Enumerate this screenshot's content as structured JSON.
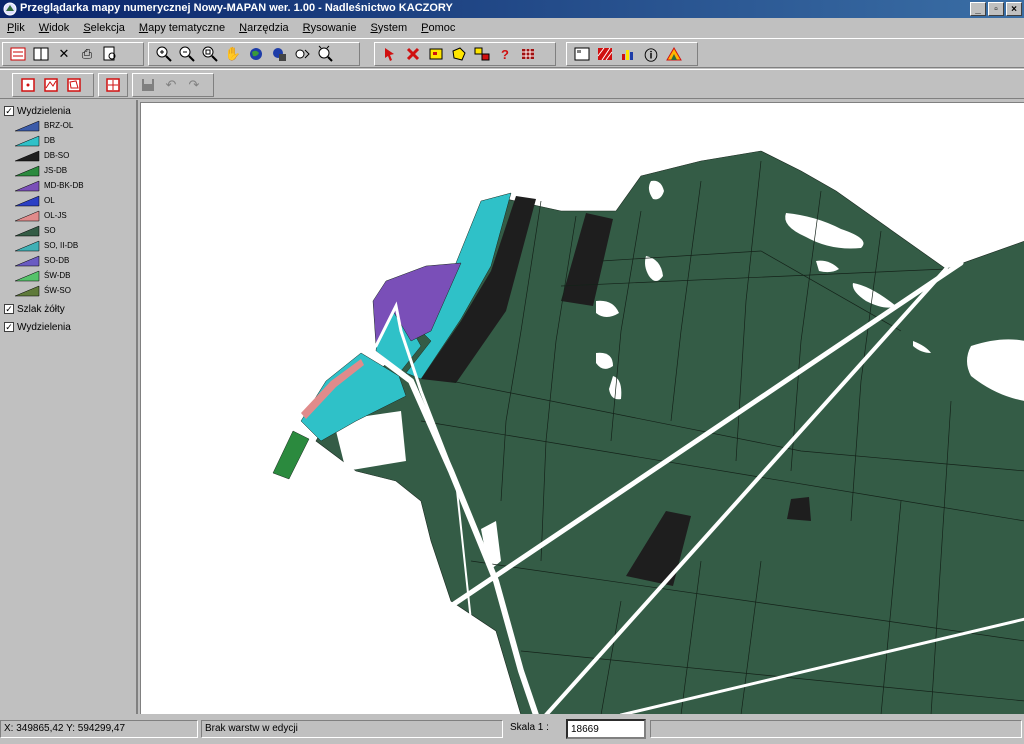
{
  "window": {
    "title": "Przeglądarka mapy numerycznej Nowy-MAPAN wer. 1.00 - Nadleśnictwo KACZORY",
    "minimize": "_",
    "maximize": "▫",
    "close": "×"
  },
  "menu": [
    "Plik",
    "Widok",
    "Selekcja",
    "Mapy tematyczne",
    "Narzędzia",
    "Rysowanie",
    "System",
    "Pomoc"
  ],
  "toolbar": {
    "glyphs": {
      "delete": "✕",
      "print": "⎙",
      "hand": "✋",
      "help": "?",
      "info": "ⓘ",
      "undo": "↶",
      "redo": "↷"
    }
  },
  "layers": {
    "group1": {
      "label": "Wydzielenia",
      "checked": "✓"
    },
    "legend": [
      {
        "label": "BRZ-OL",
        "color": "#3b5ba9"
      },
      {
        "label": "DB",
        "color": "#2fc1c8"
      },
      {
        "label": "DB-SO",
        "color": "#1e1e1e"
      },
      {
        "label": "JS-DB",
        "color": "#2b8a3e"
      },
      {
        "label": "MD-BK-DB",
        "color": "#7a4fb8"
      },
      {
        "label": "OL",
        "color": "#2b3fc4"
      },
      {
        "label": "OL-JS",
        "color": "#e08b8b"
      },
      {
        "label": "SO",
        "color": "#345c46"
      },
      {
        "label": "SO, II-DB",
        "color": "#3fb0b5"
      },
      {
        "label": "SO-DB",
        "color": "#6a5bc2"
      },
      {
        "label": "ŚW-DB",
        "color": "#55c26a"
      },
      {
        "label": "ŚW-SO",
        "color": "#5f7a3a"
      }
    ],
    "group2": {
      "label": "Szlak żółty",
      "checked": "✓"
    },
    "group3": {
      "label": "Wydzielenia",
      "checked": "✓"
    }
  },
  "status": {
    "coords": "X: 349865,42  Y: 594299,47",
    "edit_layer": "Brak warstw w edycji",
    "scale_label": "Skala 1 :",
    "scale_value": "18669"
  },
  "colors": {
    "forest": "#345c46",
    "dark": "#1e1e1e",
    "cyan": "#2fc1c8",
    "purple": "#7a4fb8",
    "green": "#2b8a3e",
    "pink": "#e08b8b"
  }
}
